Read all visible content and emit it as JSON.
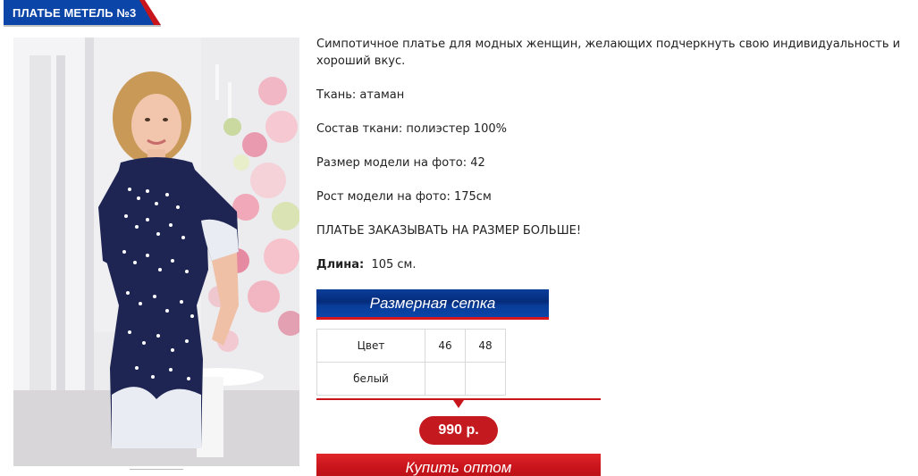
{
  "product": {
    "title": "ПЛАТЬЕ МЕТЕЛЬ №3",
    "photo_icon": "dress-photo"
  },
  "description": {
    "intro": "Симпотичное платье  для модных женщин, желающих подчеркнуть свою индивидуальность и хороший вкус.",
    "fabric": "Ткань: атаман",
    "composition": "Состав ткани: полиэстер 100%",
    "model_size": "Размер модели на фото: 42",
    "model_height": "Рост модели на фото: 175см",
    "note": "ПЛАТЬЕ ЗАКАЗЫВАТЬ НА РАЗМЕР БОЛЬШЕ!",
    "length_label": "Длина:",
    "length_value": "105 см."
  },
  "size_chart": {
    "button_label": "Размерная сетка",
    "header": [
      "Цвет",
      "46",
      "48"
    ],
    "rows": [
      [
        "белый",
        "",
        ""
      ]
    ]
  },
  "price": {
    "value": "990 р."
  },
  "buy": {
    "label": "Купить оптом"
  },
  "colors": {
    "brand_blue": "#0a3d9a",
    "accent_red": "#c41a1f"
  }
}
